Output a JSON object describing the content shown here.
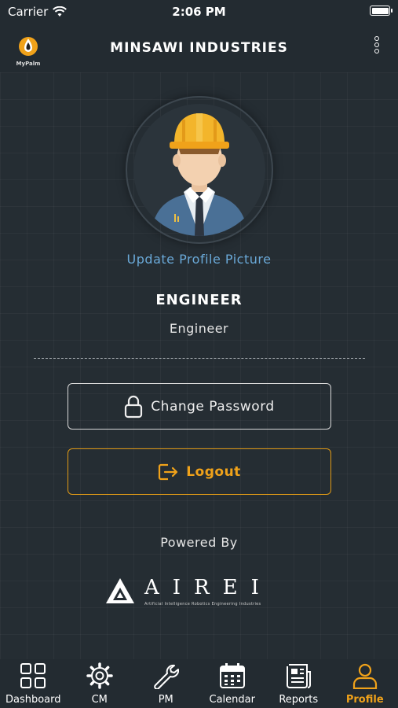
{
  "status_bar": {
    "carrier": "Carrier",
    "time": "2:06 PM"
  },
  "header": {
    "logo_text": "MyPalm",
    "title": "MINSAWI INDUSTRIES"
  },
  "profile": {
    "update_picture_label": "Update Profile Picture",
    "name": "ENGINEER",
    "role": "Engineer"
  },
  "actions": {
    "change_password_label": "Change Password",
    "logout_label": "Logout"
  },
  "footer": {
    "powered_by": "Powered By",
    "brand": "AIREI",
    "brand_subtitle": "Artificial Intelligence Robotics Engineering Industries"
  },
  "tabs": [
    {
      "label": "Dashboard",
      "icon": "dashboard-icon",
      "active": false
    },
    {
      "label": "CM",
      "icon": "gear-icon",
      "active": false
    },
    {
      "label": "PM",
      "icon": "wrench-icon",
      "active": false
    },
    {
      "label": "Calendar",
      "icon": "calendar-icon",
      "active": false
    },
    {
      "label": "Reports",
      "icon": "reports-icon",
      "active": false
    },
    {
      "label": "Profile",
      "icon": "profile-icon",
      "active": true
    }
  ],
  "colors": {
    "accent": "#f0a21a",
    "link": "#6aa9d8",
    "background": "#252d33"
  }
}
